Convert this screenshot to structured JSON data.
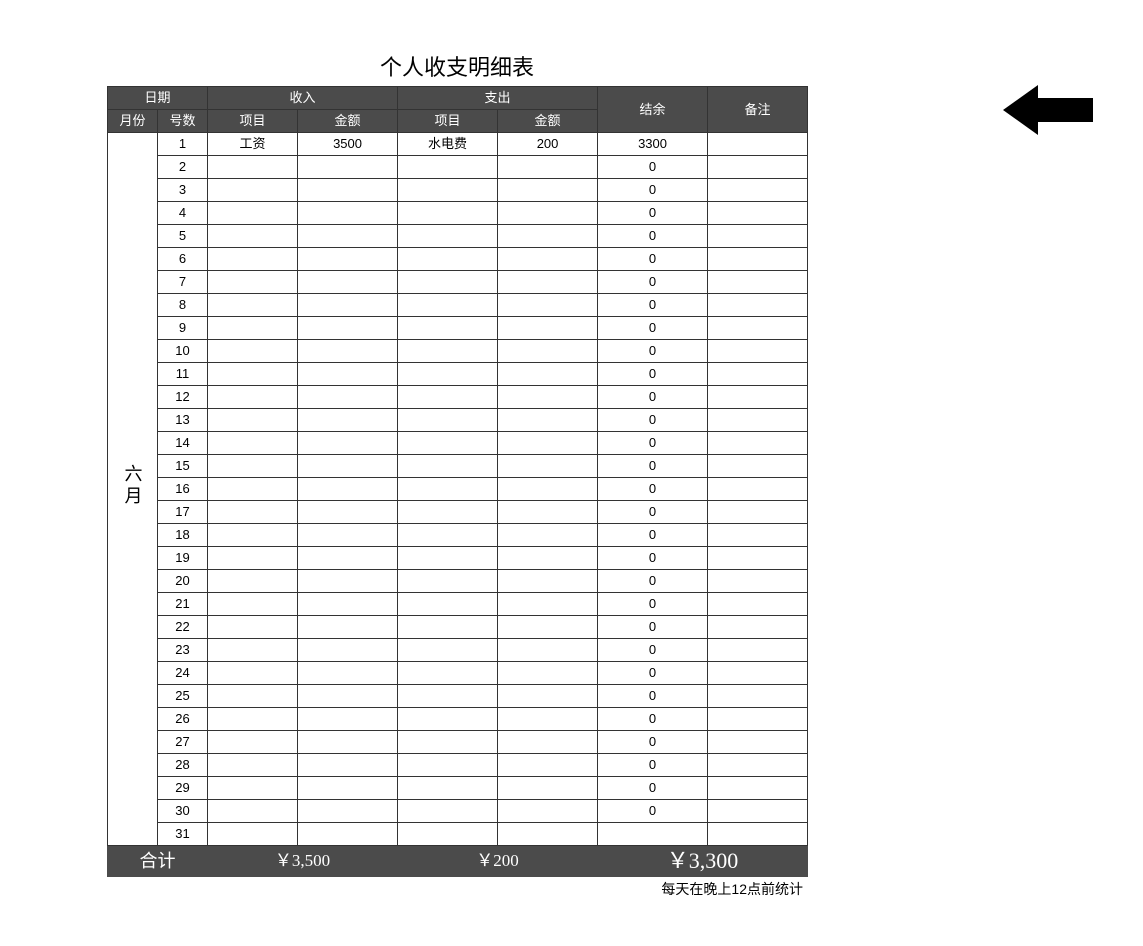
{
  "title": "个人收支明细表",
  "headers": {
    "date": "日期",
    "income": "收入",
    "expense": "支出",
    "balance": "结余",
    "note": "备注",
    "month": "月份",
    "day": "号数",
    "item": "项目",
    "amount": "金额"
  },
  "month_label": "六月",
  "rows": [
    {
      "day": "1",
      "in_item": "工资",
      "in_amt": "3500",
      "out_item": "水电费",
      "out_amt": "200",
      "bal": "3300",
      "note": ""
    },
    {
      "day": "2",
      "in_item": "",
      "in_amt": "",
      "out_item": "",
      "out_amt": "",
      "bal": "0",
      "note": ""
    },
    {
      "day": "3",
      "in_item": "",
      "in_amt": "",
      "out_item": "",
      "out_amt": "",
      "bal": "0",
      "note": ""
    },
    {
      "day": "4",
      "in_item": "",
      "in_amt": "",
      "out_item": "",
      "out_amt": "",
      "bal": "0",
      "note": ""
    },
    {
      "day": "5",
      "in_item": "",
      "in_amt": "",
      "out_item": "",
      "out_amt": "",
      "bal": "0",
      "note": ""
    },
    {
      "day": "6",
      "in_item": "",
      "in_amt": "",
      "out_item": "",
      "out_amt": "",
      "bal": "0",
      "note": ""
    },
    {
      "day": "7",
      "in_item": "",
      "in_amt": "",
      "out_item": "",
      "out_amt": "",
      "bal": "0",
      "note": ""
    },
    {
      "day": "8",
      "in_item": "",
      "in_amt": "",
      "out_item": "",
      "out_amt": "",
      "bal": "0",
      "note": ""
    },
    {
      "day": "9",
      "in_item": "",
      "in_amt": "",
      "out_item": "",
      "out_amt": "",
      "bal": "0",
      "note": ""
    },
    {
      "day": "10",
      "in_item": "",
      "in_amt": "",
      "out_item": "",
      "out_amt": "",
      "bal": "0",
      "note": ""
    },
    {
      "day": "11",
      "in_item": "",
      "in_amt": "",
      "out_item": "",
      "out_amt": "",
      "bal": "0",
      "note": ""
    },
    {
      "day": "12",
      "in_item": "",
      "in_amt": "",
      "out_item": "",
      "out_amt": "",
      "bal": "0",
      "note": ""
    },
    {
      "day": "13",
      "in_item": "",
      "in_amt": "",
      "out_item": "",
      "out_amt": "",
      "bal": "0",
      "note": ""
    },
    {
      "day": "14",
      "in_item": "",
      "in_amt": "",
      "out_item": "",
      "out_amt": "",
      "bal": "0",
      "note": ""
    },
    {
      "day": "15",
      "in_item": "",
      "in_amt": "",
      "out_item": "",
      "out_amt": "",
      "bal": "0",
      "note": ""
    },
    {
      "day": "16",
      "in_item": "",
      "in_amt": "",
      "out_item": "",
      "out_amt": "",
      "bal": "0",
      "note": ""
    },
    {
      "day": "17",
      "in_item": "",
      "in_amt": "",
      "out_item": "",
      "out_amt": "",
      "bal": "0",
      "note": ""
    },
    {
      "day": "18",
      "in_item": "",
      "in_amt": "",
      "out_item": "",
      "out_amt": "",
      "bal": "0",
      "note": ""
    },
    {
      "day": "19",
      "in_item": "",
      "in_amt": "",
      "out_item": "",
      "out_amt": "",
      "bal": "0",
      "note": ""
    },
    {
      "day": "20",
      "in_item": "",
      "in_amt": "",
      "out_item": "",
      "out_amt": "",
      "bal": "0",
      "note": ""
    },
    {
      "day": "21",
      "in_item": "",
      "in_amt": "",
      "out_item": "",
      "out_amt": "",
      "bal": "0",
      "note": ""
    },
    {
      "day": "22",
      "in_item": "",
      "in_amt": "",
      "out_item": "",
      "out_amt": "",
      "bal": "0",
      "note": ""
    },
    {
      "day": "23",
      "in_item": "",
      "in_amt": "",
      "out_item": "",
      "out_amt": "",
      "bal": "0",
      "note": ""
    },
    {
      "day": "24",
      "in_item": "",
      "in_amt": "",
      "out_item": "",
      "out_amt": "",
      "bal": "0",
      "note": ""
    },
    {
      "day": "25",
      "in_item": "",
      "in_amt": "",
      "out_item": "",
      "out_amt": "",
      "bal": "0",
      "note": ""
    },
    {
      "day": "26",
      "in_item": "",
      "in_amt": "",
      "out_item": "",
      "out_amt": "",
      "bal": "0",
      "note": ""
    },
    {
      "day": "27",
      "in_item": "",
      "in_amt": "",
      "out_item": "",
      "out_amt": "",
      "bal": "0",
      "note": ""
    },
    {
      "day": "28",
      "in_item": "",
      "in_amt": "",
      "out_item": "",
      "out_amt": "",
      "bal": "0",
      "note": ""
    },
    {
      "day": "29",
      "in_item": "",
      "in_amt": "",
      "out_item": "",
      "out_amt": "",
      "bal": "0",
      "note": ""
    },
    {
      "day": "30",
      "in_item": "",
      "in_amt": "",
      "out_item": "",
      "out_amt": "",
      "bal": "0",
      "note": ""
    },
    {
      "day": "31",
      "in_item": "",
      "in_amt": "",
      "out_item": "",
      "out_amt": "",
      "bal": "",
      "note": ""
    }
  ],
  "totals": {
    "label": "合计",
    "income": "￥3,500",
    "expense": "￥200",
    "balance": "￥3,300"
  },
  "footer_note": "每天在晚上12点前统计"
}
